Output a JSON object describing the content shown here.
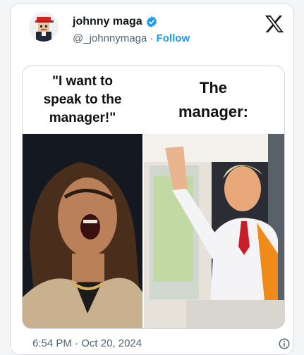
{
  "author": {
    "display_name": "johnny maga",
    "handle": "@_johnnymaga",
    "separator": "·",
    "follow_label": "Follow",
    "verified": true
  },
  "meme": {
    "left_caption": "\"I want to\nspeak to the\nmanager!\"",
    "right_caption": "The\nmanager:"
  },
  "footer": {
    "time": "6:54 PM",
    "separator": "·",
    "date": "Oct 20, 2024"
  },
  "icons": {
    "platform": "x-logo-icon",
    "verified": "verified-badge-icon",
    "info": "info-icon"
  },
  "colors": {
    "accent": "#1d9bf0",
    "text_primary": "#0f1419",
    "text_secondary": "#536471",
    "avatar_hat": "#d92323"
  }
}
